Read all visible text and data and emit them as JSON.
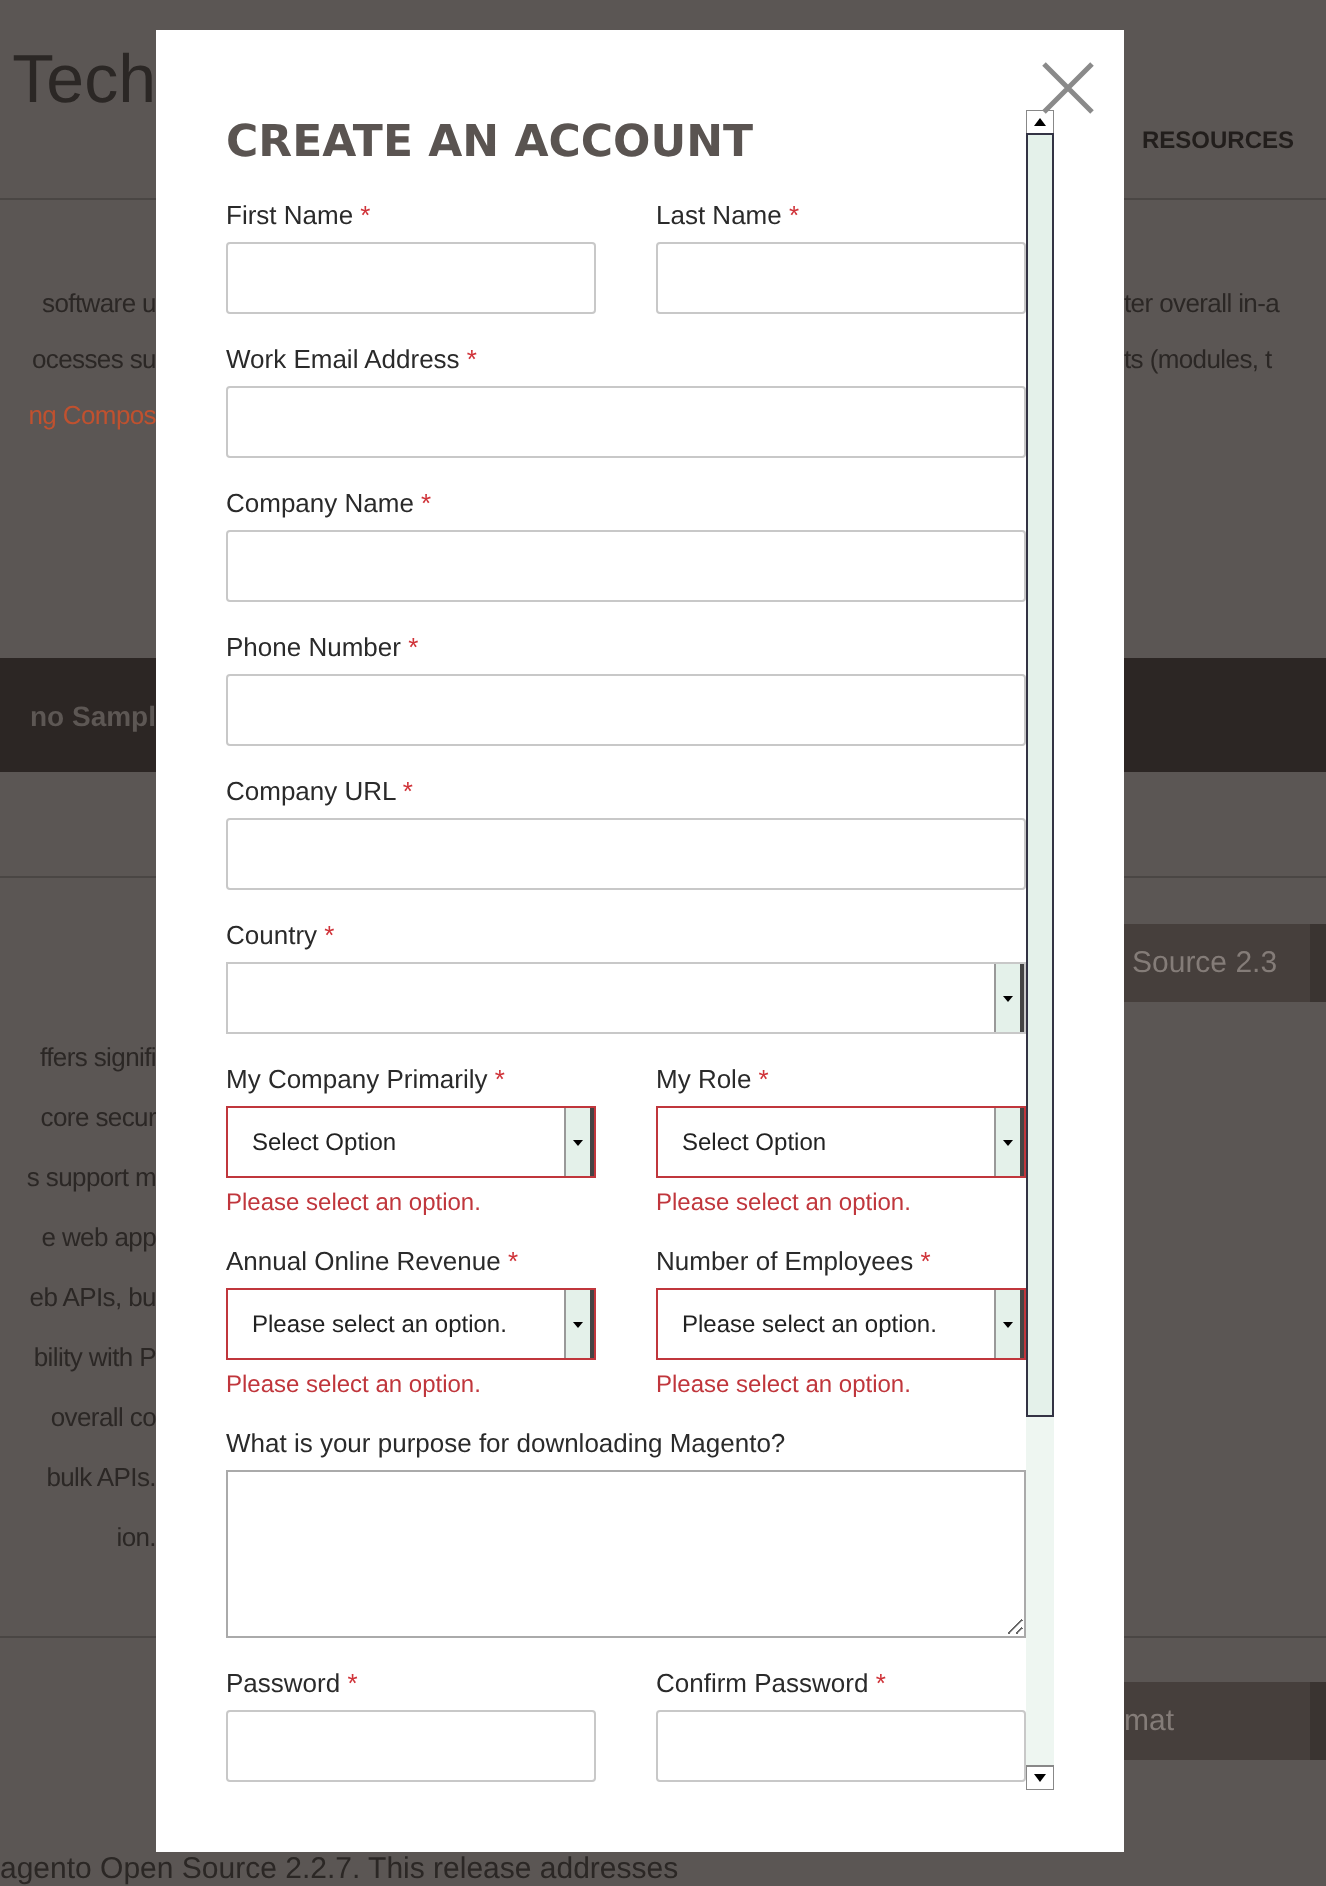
{
  "background": {
    "logo_text": "Tech",
    "nav_item": "RESOURCES",
    "intro_left": [
      {
        "text": "software u",
        "kind": "plain"
      },
      {
        "text": "ocesses su",
        "kind": "plain"
      },
      {
        "text": "ng Compos",
        "kind": "link"
      }
    ],
    "intro_right": [
      "ter overall in-a",
      "ts (modules, t"
    ],
    "banner_text": "no Sampl",
    "body_left": [
      "ffers signifi",
      "core secur",
      "s support m",
      "e web app",
      "eb APIs, bu",
      "bility with P",
      "overall co",
      "bulk APIs.",
      "ion."
    ],
    "version_select": "Source 2.3",
    "format_select": "mat",
    "footer_text": "agento Open Source 2.2.7. This release addresses"
  },
  "dialog": {
    "title": "CREATE AN ACCOUNT",
    "required_mark": "*",
    "rows": [
      [
        {
          "kind": "text",
          "label": "First Name",
          "required": true
        },
        {
          "kind": "text",
          "label": "Last Name",
          "required": true
        }
      ],
      [
        {
          "kind": "text",
          "label": "Work Email Address",
          "required": true
        }
      ],
      [
        {
          "kind": "text",
          "label": "Company Name",
          "required": true
        }
      ],
      [
        {
          "kind": "text",
          "label": "Phone Number",
          "required": true
        }
      ],
      [
        {
          "kind": "text",
          "label": "Company URL",
          "required": true
        }
      ],
      [
        {
          "kind": "select",
          "label": "Country",
          "required": true
        }
      ],
      [
        {
          "kind": "select",
          "label": "My Company Primarily",
          "required": true,
          "value": "Select Option",
          "error": "Please select an option."
        },
        {
          "kind": "select",
          "label": "My Role",
          "required": true,
          "value": "Select Option",
          "error": "Please select an option."
        }
      ],
      [
        {
          "kind": "select",
          "label": "Annual Online Revenue",
          "required": true,
          "value": "Please select an option.",
          "error": "Please select an option."
        },
        {
          "kind": "select",
          "label": "Number of Employees",
          "required": true,
          "value": "Please select an option.",
          "error": "Please select an option."
        }
      ],
      [
        {
          "kind": "textarea",
          "label": "What is your purpose for downloading Magento?",
          "required": false
        }
      ],
      [
        {
          "kind": "text",
          "label": "Password",
          "required": true
        },
        {
          "kind": "text",
          "label": "Confirm Password",
          "required": true
        }
      ]
    ]
  }
}
